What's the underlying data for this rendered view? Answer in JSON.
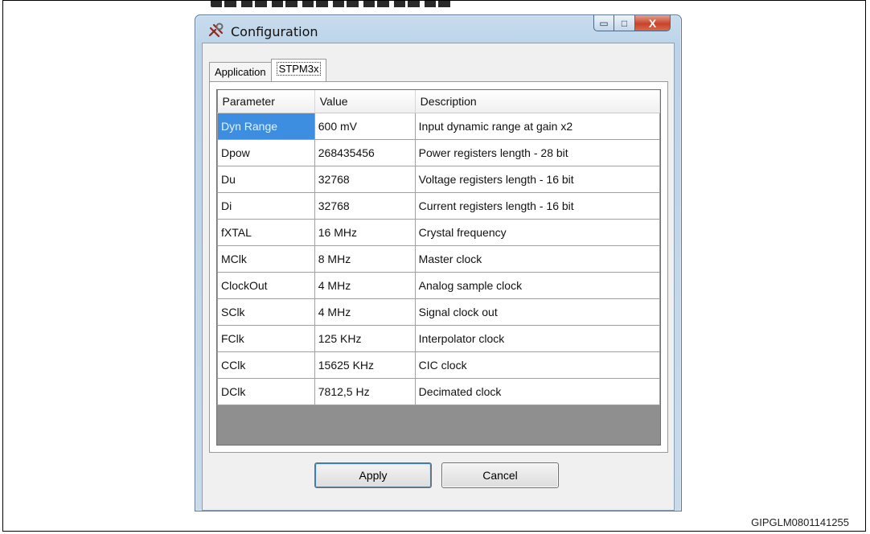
{
  "window": {
    "title": "Configuration",
    "icon": "configuration-app-icon",
    "minimize_glyph": "▭",
    "maximize_glyph": "□",
    "close_glyph": "X"
  },
  "tabs": [
    {
      "label": "Application",
      "active": false
    },
    {
      "label": "STPM3x",
      "active": true
    }
  ],
  "table": {
    "headers": [
      "Parameter",
      "Value",
      "Description"
    ],
    "rows": [
      {
        "parameter": "Dyn Range",
        "value": "600 mV",
        "description": "Input dynamic range at gain x2",
        "selected": true
      },
      {
        "parameter": "Dpow",
        "value": "268435456",
        "description": "Power registers length - 28 bit"
      },
      {
        "parameter": "Du",
        "value": "32768",
        "description": "Voltage registers length - 16 bit"
      },
      {
        "parameter": "Di",
        "value": "32768",
        "description": "Current registers length - 16 bit"
      },
      {
        "parameter": "fXTAL",
        "value": "16 MHz",
        "description": "Crystal frequency"
      },
      {
        "parameter": "MClk",
        "value": "8 MHz",
        "description": "Master clock"
      },
      {
        "parameter": "ClockOut",
        "value": "4 MHz",
        "description": "Analog sample clock"
      },
      {
        "parameter": "SClk",
        "value": "4 MHz",
        "description": "Signal clock out"
      },
      {
        "parameter": "FClk",
        "value": "125 KHz",
        "description": "Interpolator clock"
      },
      {
        "parameter": "CClk",
        "value": "15625 KHz",
        "description": "CIC clock"
      },
      {
        "parameter": "DClk",
        "value": "7812,5 Hz",
        "description": "Decimated clock"
      }
    ]
  },
  "buttons": {
    "apply": "Apply",
    "cancel": "Cancel"
  },
  "footer": {
    "reference": "GIPGLM0801141255"
  },
  "colors": {
    "selection": "#3d8ee0",
    "title_bar": "#c8dced",
    "close_button": "#c8442a"
  }
}
